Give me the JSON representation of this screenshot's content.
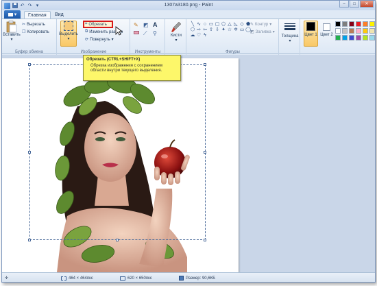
{
  "window": {
    "title": "1307a3180.png - Paint"
  },
  "tabs": {
    "file": "▾",
    "home": "Главная",
    "view": "Вид"
  },
  "clipboard": {
    "paste": "Вставить",
    "cut": "Вырезать",
    "copy": "Копировать",
    "label": "Буфер обмена"
  },
  "image": {
    "select": "Выделить",
    "crop": "Обрезать",
    "resize": "Изменить размер",
    "rotate": "Повернуть",
    "label": "Изображение"
  },
  "tools": {
    "label": "Инструменты"
  },
  "brushes": {
    "label": "Кисти"
  },
  "shapes": {
    "label": "Фигуры",
    "outline": "Контур",
    "fill": "Заливка"
  },
  "size": {
    "label": "Толщина"
  },
  "colors": {
    "color1": "Цвет 1",
    "color2": "Цвет 2"
  },
  "tooltip": {
    "title": "Обрезать (CTRL+SHIFT+X)",
    "description": "Обрезка изображения с сохранением области внутри текущего выделения."
  },
  "status": {
    "selection_size": "464 × 464пкс",
    "image_size": "620 × 650пкс",
    "file_size": "Размер: 90,6КБ"
  },
  "palette_colors": [
    "#000000",
    "#7f7f7f",
    "#880015",
    "#ed1c24",
    "#ff7f27",
    "#fff200",
    "#ffffff",
    "#c3c3c3",
    "#b97a57",
    "#ffaec9",
    "#ffc90e",
    "#efe4b0",
    "#22b14c",
    "#00a2e8",
    "#3f48cc",
    "#a349a4",
    "#b5e61d",
    "#99d9ea"
  ],
  "accent": "#d81a1a"
}
